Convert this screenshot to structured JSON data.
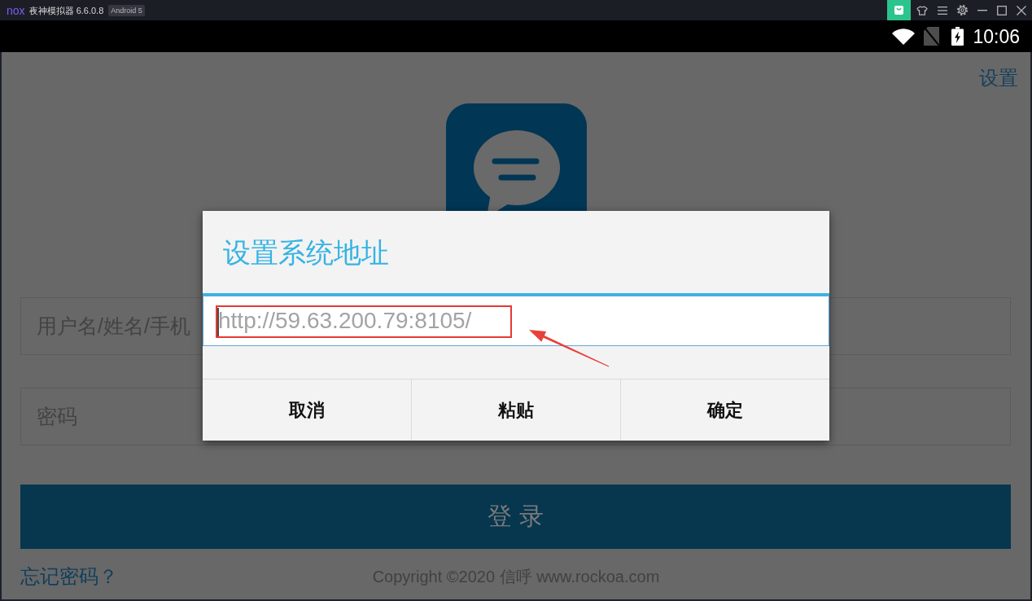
{
  "emulator_bar": {
    "logo": "nox",
    "title": "夜神模拟器 6.6.0.8",
    "badge": "Android 5"
  },
  "status_bar": {
    "time": "10:06"
  },
  "login_screen": {
    "settings_link": "设置",
    "username_field": {
      "placeholder": "用户名/姓名/手机"
    },
    "password_field": {
      "placeholder": "密码"
    },
    "login_button": "登 录",
    "forgot_password_link": "忘记密码？",
    "copyright": "Copyright ©2020 信呼 www.rockoa.com"
  },
  "dialog": {
    "title": "设置系统地址",
    "url_field": {
      "placeholder": "http://59.63.200.79:8105/",
      "focused": true
    },
    "buttons": [
      "取消",
      "粘贴",
      "确定"
    ]
  }
}
